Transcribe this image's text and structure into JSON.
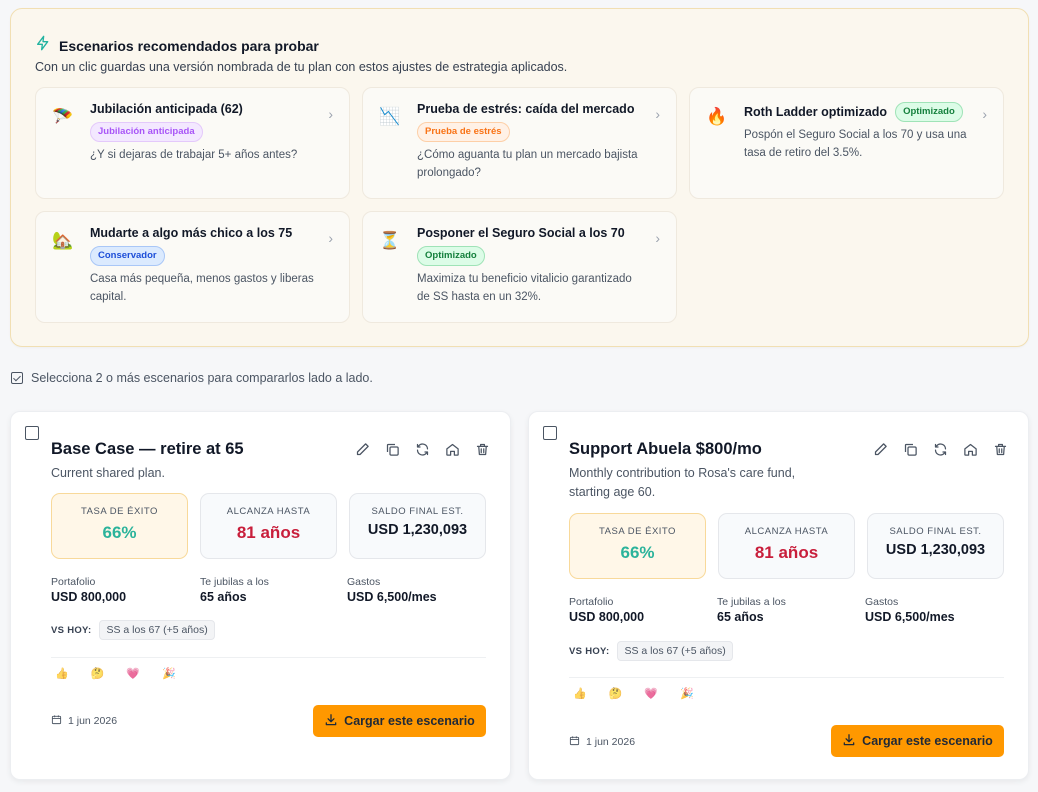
{
  "recommended": {
    "title": "Escenarios recomendados para probar",
    "subtitle": "Con un clic guardas una versión nombrada de tu plan con estos ajustes de estrategia aplicados.",
    "cards": [
      {
        "icon": "📉",
        "title": "Jubilación anticipada (62)",
        "badge": "Jubilación anticipada",
        "desc": "¿Y si dejaras de trabajar 5+ años antes?"
      },
      {
        "icon": "📉",
        "title": "Prueba de estrés: caída del mercado",
        "badge": "Prueba de estrés",
        "desc": "¿Cómo aguanta tu plan un mercado bajista prolongado?"
      },
      {
        "icon": "🔥",
        "title": "Roth Ladder optimizado",
        "badge": "Optimizado",
        "desc": "Pospón el Seguro Social a los 70 y usa una tasa de retiro del 3.5%."
      },
      {
        "icon": "🏠",
        "title": "Mudarte a algo más chico a los 75",
        "badge": "Conservador",
        "desc": "Casa más pequeña, menos gastos y liberas capital."
      },
      {
        "icon": "⏳",
        "title": "Posponer el Seguro Social a los 70",
        "badge": "Optimizado",
        "desc": "Maximiza tu beneficio vitalicio garantizado de SS hasta en un 32%."
      }
    ]
  },
  "compare_hint": "Selecciona 2 o más escenarios para compararlos lado a lado.",
  "scenarios": [
    {
      "title": "Base Case — retire at 65",
      "desc": "Current shared plan.",
      "success_label": "TASA DE ÉXITO",
      "success_value": "66%",
      "reach_label": "ALCANZA HASTA",
      "reach_value": "81 años",
      "balance_label": "SALDO FINAL EST.",
      "balance_value": "USD 1,230,093",
      "portfolio_label": "Portafolio",
      "portfolio_value": "USD 800,000",
      "retire_label": "Te jubilas a los",
      "retire_value": "65 años",
      "expenses_label": "Gastos",
      "expenses_value": "USD 6,500/mes",
      "vs_label": "VS HOY:",
      "vs_chip": "SS a los 67 (+5 años)",
      "reactions": [
        "👍",
        "🤔",
        "💗",
        "🎉"
      ],
      "date": "1 jun 2026",
      "load_label": "Cargar este escenario"
    },
    {
      "title": "Support Abuela $800/mo",
      "desc": "Monthly contribution to Rosa's care fund, starting age 60.",
      "success_label": "TASA DE ÉXITO",
      "success_value": "66%",
      "reach_label": "ALCANZA HASTA",
      "reach_value": "81 años",
      "balance_label": "SALDO FINAL EST.",
      "balance_value": "USD 1,230,093",
      "portfolio_label": "Portafolio",
      "portfolio_value": "USD 800,000",
      "retire_label": "Te jubilas a los",
      "retire_value": "65 años",
      "expenses_label": "Gastos",
      "expenses_value": "USD 6,500/mes",
      "vs_label": "VS HOY:",
      "vs_chip": "SS a los 67 (+5 años)",
      "reactions": [
        "👍",
        "🤔",
        "💗",
        "🎉"
      ],
      "date": "1 jun 2026",
      "load_label": "Cargar este escenario"
    }
  ]
}
